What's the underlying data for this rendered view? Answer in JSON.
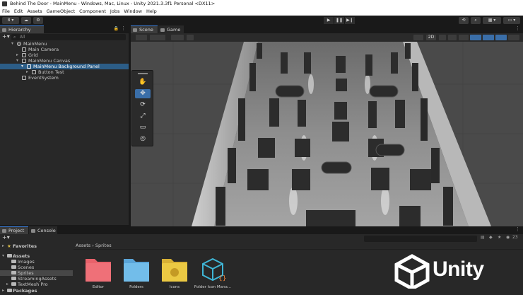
{
  "window": {
    "title": "Behind The Door - MainMenu - Windows, Mac, Linux - Unity 2021.3.3f1 Personal <DX11>"
  },
  "menubar": [
    "File",
    "Edit",
    "Assets",
    "GameObject",
    "Component",
    "Jobs",
    "Window",
    "Help"
  ],
  "toolbar": {
    "account_label": "8 ▾",
    "play": "▶",
    "pause": "❚❚",
    "step": "▶❙",
    "layers_label": "2D"
  },
  "hierarchy": {
    "tab_label": "Hierarchy",
    "search_placeholder": "All",
    "items": [
      {
        "label": "MainMenu",
        "depth": 0,
        "expanded": true,
        "selected": false
      },
      {
        "label": "Main Camera",
        "depth": 1,
        "expanded": false,
        "selected": false
      },
      {
        "label": "Grid",
        "depth": 1,
        "expanded": false,
        "selected": false
      },
      {
        "label": "MainMenu Canvas",
        "depth": 1,
        "expanded": true,
        "selected": false
      },
      {
        "label": "MainMenu Background Panel",
        "depth": 2,
        "expanded": true,
        "selected": true
      },
      {
        "label": "Button Test",
        "depth": 3,
        "expanded": false,
        "selected": false
      },
      {
        "label": "EventSystem",
        "depth": 1,
        "expanded": false,
        "selected": false
      }
    ]
  },
  "scene": {
    "tab_scene": "Scene",
    "tab_game": "Game",
    "mode_2d": "2D"
  },
  "project": {
    "tab_project": "Project",
    "tab_console": "Console",
    "breadcrumb_root": "Assets",
    "breadcrumb_sep": "›",
    "breadcrumb_leaf": "Sprites",
    "count_badge": "23",
    "tree": [
      {
        "label": "Favorites",
        "kind": "header"
      },
      {
        "label": "Assets",
        "kind": "header"
      },
      {
        "label": "Images",
        "kind": "folder"
      },
      {
        "label": "Scenes",
        "kind": "folder"
      },
      {
        "label": "Sprites",
        "kind": "folder",
        "selected": true
      },
      {
        "label": "StreamingAssets",
        "kind": "folder"
      },
      {
        "label": "TextMesh Pro",
        "kind": "folder"
      },
      {
        "label": "Packages",
        "kind": "header"
      }
    ],
    "assets": [
      {
        "label": "Editor",
        "color": "#e8626b"
      },
      {
        "label": "Folders",
        "color": "#6ab4e4"
      },
      {
        "label": "Icons",
        "color": "#e7c23e"
      },
      {
        "label": "Folder Icon Mana...",
        "color": "#3fb6d6"
      }
    ]
  },
  "brand": {
    "wordmark": "Unity"
  },
  "colors": {
    "accent": "#3a6ea8",
    "selection": "#2c5d87"
  }
}
